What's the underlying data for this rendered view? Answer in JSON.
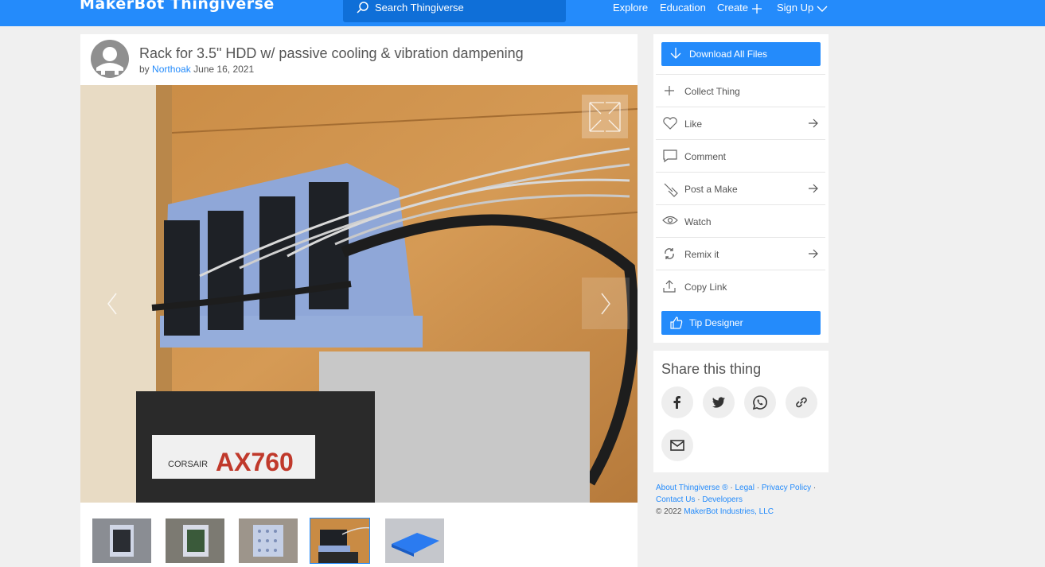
{
  "header": {
    "logo": "MakerBot Thingiverse",
    "search_placeholder": "Search Thingiverse",
    "nav": {
      "explore": "Explore",
      "education": "Education",
      "create": "Create",
      "signup": "Sign Up"
    }
  },
  "thing": {
    "title": "Rack for 3.5\" HDD w/ passive cooling & vibration dampening",
    "by": "by",
    "author": "Northoak",
    "date": "June 16, 2021"
  },
  "actions": {
    "download": "Download All Files",
    "items": [
      "Collect Thing",
      "Like",
      "Comment",
      "Post a Make",
      "Watch",
      "Remix it",
      "Copy Link"
    ],
    "tip": "Tip Designer"
  },
  "share": {
    "title": "Share this thing"
  },
  "footer": {
    "about": "About Thingiverse ®",
    "legal": "Legal",
    "privacy": "Privacy Policy",
    "contact": "Contact Us",
    "developers": "Developers",
    "copyright_prefix": "© 2022",
    "company": "MakerBot Industries, LLC"
  },
  "colors": {
    "brand": "#248bfb",
    "brand_dark": "#0f6fd8"
  },
  "icons": [
    "search-icon",
    "plus-icon",
    "chevron-down-icon",
    "download-icon",
    "heart-icon",
    "comment-icon",
    "post-make-icon",
    "eye-icon",
    "remix-icon",
    "share-upload-icon",
    "thumbs-up-icon",
    "facebook-icon",
    "twitter-icon",
    "whatsapp-icon",
    "link-icon",
    "mail-icon",
    "expand-icon",
    "arrow-right-icon"
  ]
}
